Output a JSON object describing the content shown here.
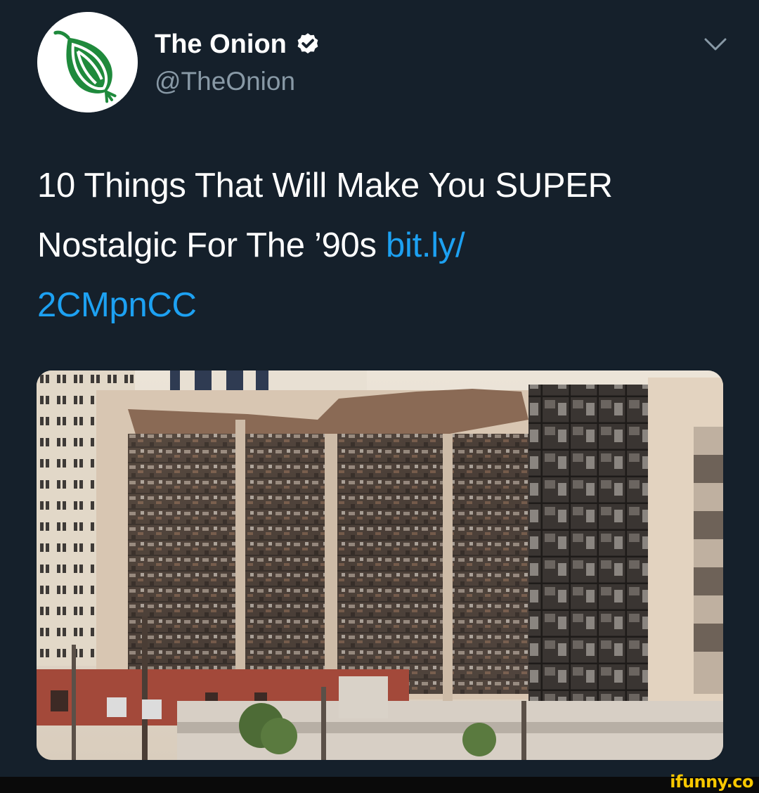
{
  "account": {
    "display_name": "The Onion",
    "handle": "@TheOnion",
    "verified": true
  },
  "tweet": {
    "text": "10 Things That Will Make You SUPER Nostalgic For The ’90s ",
    "link_part1": "bit.ly/",
    "link_part2": "2CMpnCC"
  },
  "icons": {
    "avatar": "onion-logo-icon",
    "verified": "verified-badge-icon",
    "menu": "chevron-down-icon"
  },
  "colors": {
    "background": "#15202b",
    "text": "#ffffff",
    "secondary_text": "#8899a6",
    "link": "#1da1f2",
    "verified_badge": "#ffffff",
    "onion_green": "#1f8a3c",
    "watermark": "#f9c800"
  },
  "watermark": "ifunny.co"
}
